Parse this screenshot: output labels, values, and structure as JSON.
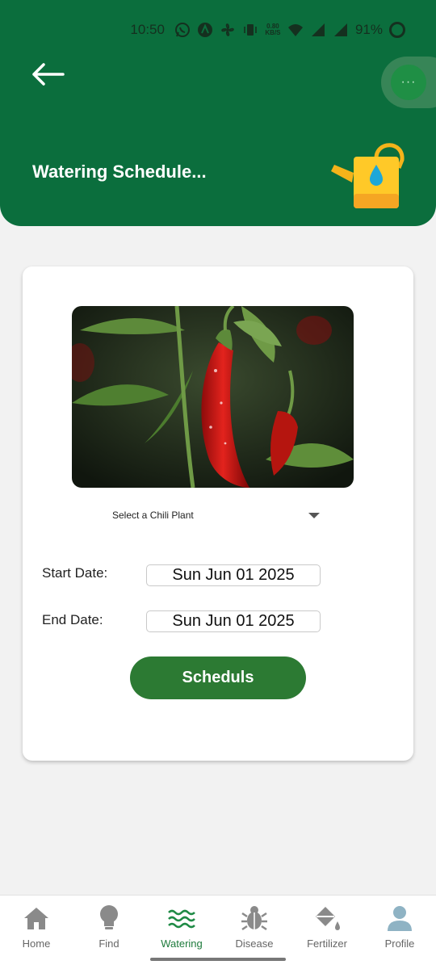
{
  "status_bar": {
    "time": "10:50",
    "net_speed_value": "0.80",
    "net_speed_unit": "KB/S",
    "battery": "91%"
  },
  "header": {
    "title": "Watering Schedule...",
    "menu_dots": "···",
    "color": "#0b6e3d"
  },
  "form": {
    "select_label": "Select a Chili Plant",
    "start_label": "Start Date:",
    "start_value": "Sun Jun 01 2025",
    "end_label": "End Date:",
    "end_value": "Sun Jun 01 2025",
    "submit_label": "Scheduls",
    "submit_color": "#2c7a33"
  },
  "nav": {
    "items": [
      {
        "label": "Home",
        "icon": "home-icon"
      },
      {
        "label": "Find",
        "icon": "lightbulb-icon"
      },
      {
        "label": "Watering",
        "icon": "water-waves-icon",
        "active": true
      },
      {
        "label": "Disease",
        "icon": "bug-icon"
      },
      {
        "label": "Fertilizer",
        "icon": "fertilizer-icon"
      },
      {
        "label": "Profile",
        "icon": "person-icon"
      }
    ],
    "active_color": "#1e7b3c"
  }
}
